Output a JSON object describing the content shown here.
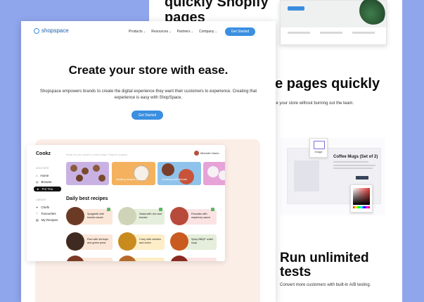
{
  "colors": {
    "backdrop": "#8fa6ec",
    "accent": "#3a8fe0",
    "panel": "#fbeee6"
  },
  "back_page": {
    "top_heading_line1": "quickly Shopify",
    "top_heading_line2": "pages",
    "mid_heading": "ce pages quickly",
    "mid_text": "timize your store without burning out the team.",
    "editor": {
      "image_label": "Image",
      "product_title": "Coffee Mugs (Set of 2)"
    },
    "bottom_heading_line1": "Run unlimited",
    "bottom_heading_line2": "tests",
    "bottom_text": "Convert more customers with built-in A/B testing."
  },
  "nav": {
    "brand": "shopspace",
    "brand_icon": "shopspace-logo-icon",
    "items": [
      "Products",
      "Resources",
      "Partners",
      "Company"
    ],
    "cta": "Get Started"
  },
  "hero": {
    "title": "Create your store with ease.",
    "subtitle": "Shopspace empowers brands to create the digital experience they want their customers to experience. Creating that experience is easy with ShopSpace.",
    "button": "Get Started"
  },
  "app": {
    "brand": "Cookz",
    "search_placeholder": "What do you want to cook today? Search recipes...",
    "user": "Michelle Harris",
    "sidebar": {
      "section1": "DISCOVER",
      "items1": [
        "Home",
        "Browse",
        "For You"
      ],
      "section2": "LIBRARY",
      "items2": [
        "Chefs",
        "Favourites",
        "My Recipes"
      ]
    },
    "banners": [
      "",
      "Healthy recipes at home",
      "Cooking with friends",
      ""
    ],
    "section_title": "Daily best recipes",
    "cards": [
      "Spaghetti with tomato sauce",
      "Salad with rice and tomato",
      "Pancake with raspberry sauce",
      "Rice with shrimps and green peas",
      "Curry with chicken and onion",
      "Spicy BBQF cutlet soup"
    ]
  }
}
